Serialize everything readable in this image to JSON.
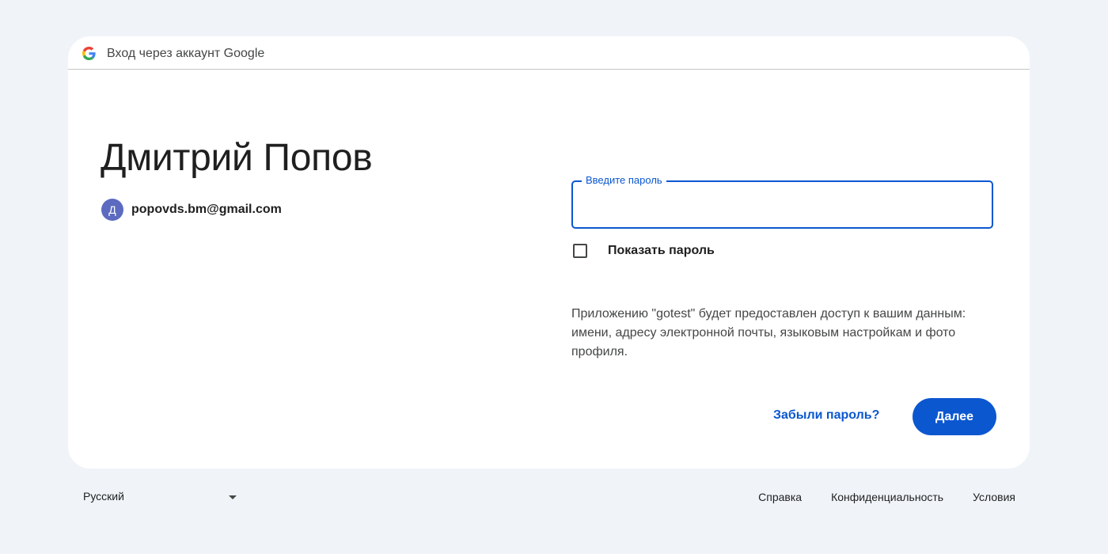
{
  "header": {
    "title": "Вход через аккаунт Google",
    "logo_icon": "google-g-icon"
  },
  "account": {
    "name": "Дмитрий Попов",
    "avatar_letter": "Д",
    "avatar_color": "#5c6bc0",
    "email": "popovds.bm@gmail.com"
  },
  "password": {
    "label": "Введите пароль",
    "value": ""
  },
  "show_password": {
    "label": "Показать пароль",
    "checked": false
  },
  "consent": {
    "text": "Приложению \"gotest\" будет предоставлен доступ к вашим данным: имени, адресу электронной почты, языковым настройкам и фото профиля."
  },
  "actions": {
    "forgot_label": "Забыли пароль?",
    "next_label": "Далее"
  },
  "footer": {
    "language": "Русский",
    "links": [
      "Справка",
      "Конфиденциальность",
      "Условия"
    ]
  },
  "colors": {
    "accent": "#0b57d0",
    "background": "#f0f4f9",
    "card": "#ffffff"
  }
}
